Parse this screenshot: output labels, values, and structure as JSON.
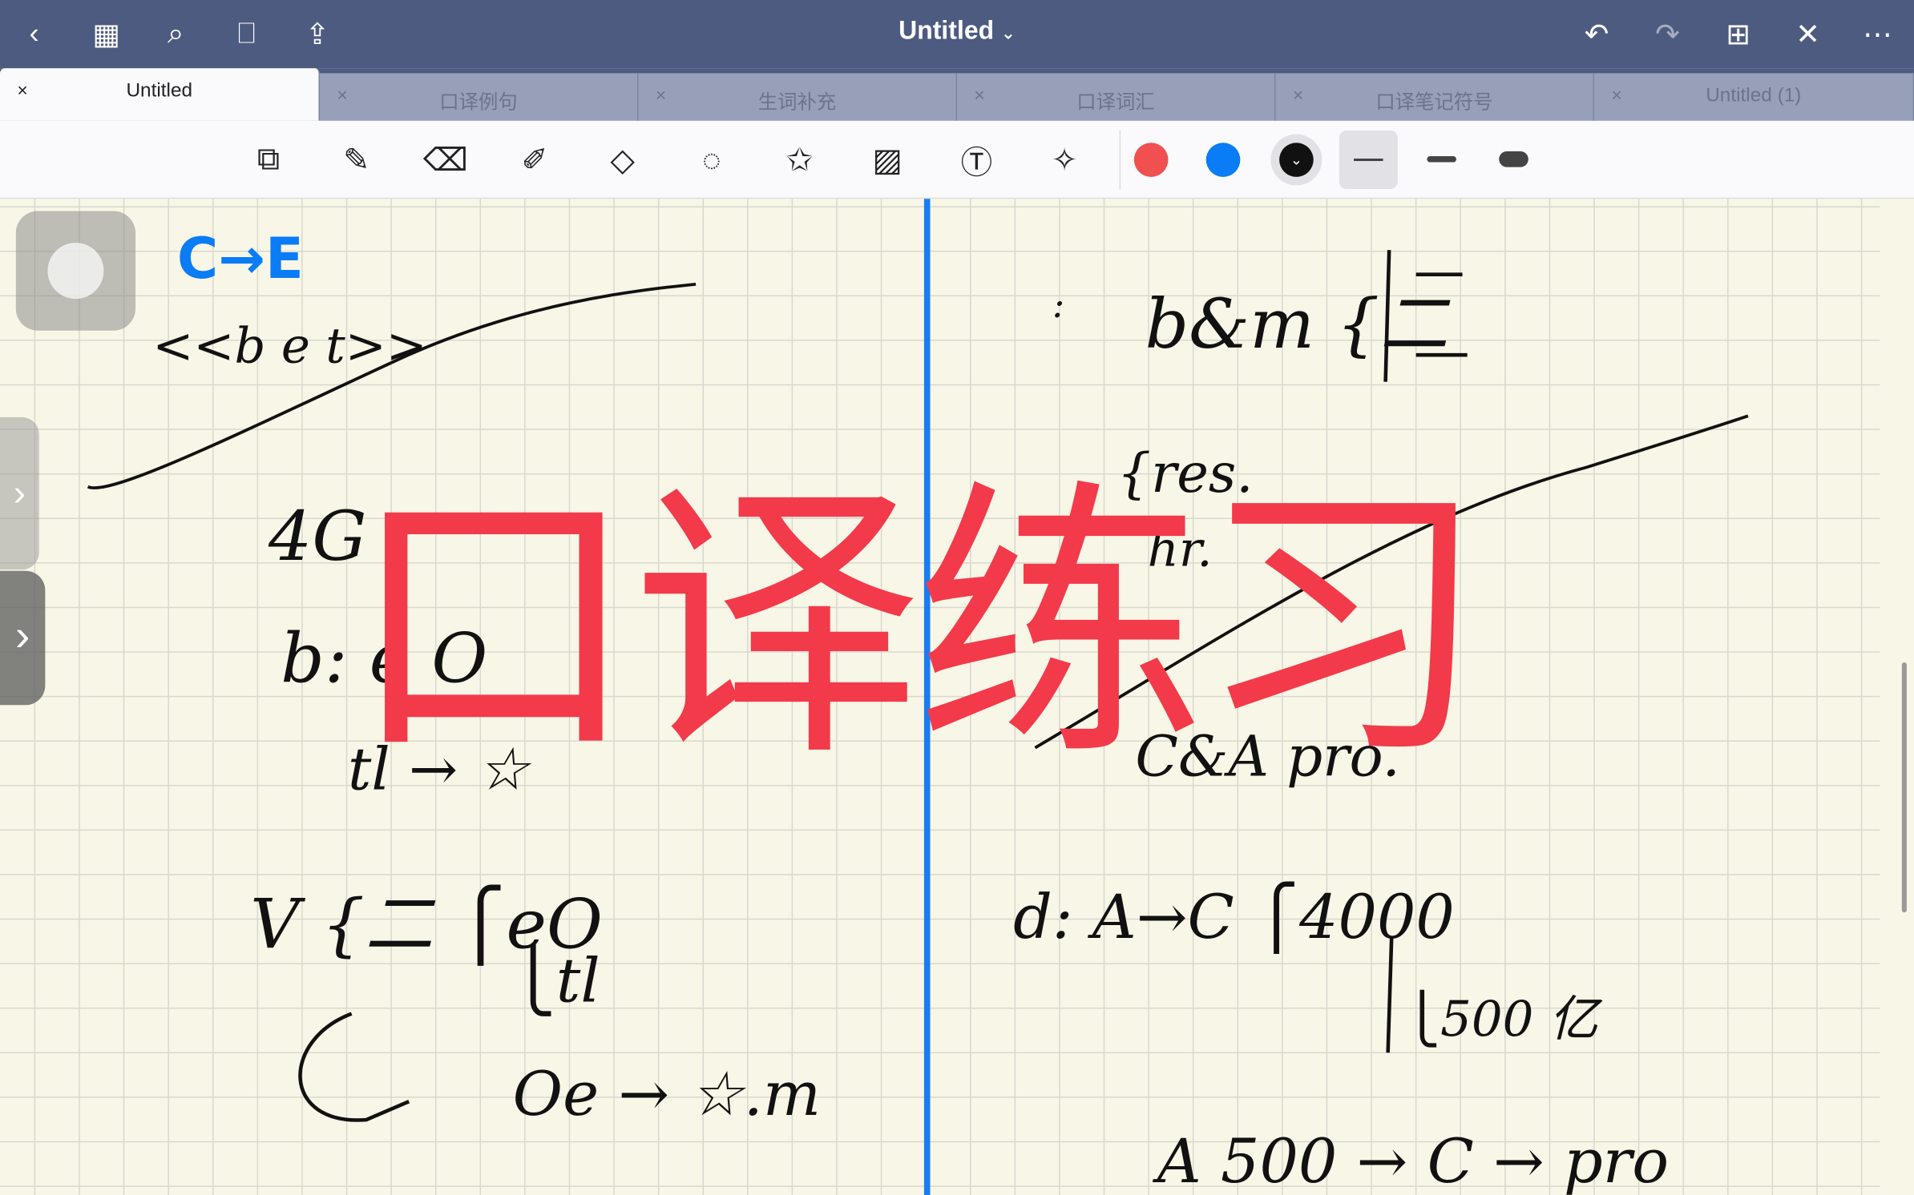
{
  "header": {
    "title": "Untitled",
    "title_caret": "⌄"
  },
  "tabs": [
    {
      "label": "Untitled",
      "active": true
    },
    {
      "label": "口译例句"
    },
    {
      "label": "生词补充"
    },
    {
      "label": "口译词汇"
    },
    {
      "label": "口译笔记符号"
    },
    {
      "label": "Untitled (1)"
    }
  ],
  "tab_close": "×",
  "colors": {
    "accent": "#1a7cf0",
    "red": "#f05050",
    "blue": "#0a7cf5",
    "black": "#111111",
    "overlay": "#f33a4a",
    "topbar": "#4e5b80"
  },
  "overlay_text": "口译练习",
  "notes": {
    "left": [
      "C→E",
      "<<b  e  t>>",
      "4G :",
      "b: e O",
      "tl → ☆",
      "V {二  ⎧eO",
      "⎩tl",
      "Oe → ☆.m"
    ],
    "right": [
      ":",
      "b&m {二",
      "{res.",
      "hr.",
      "C&A   pro.",
      "d:   A→C  ⎧4000",
      "⎩500 亿",
      "A 500 → C → pro"
    ]
  }
}
